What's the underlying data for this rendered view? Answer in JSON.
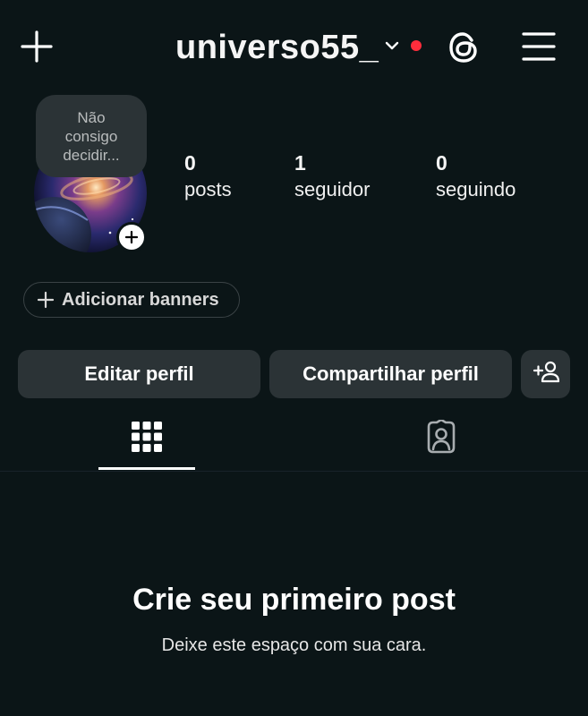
{
  "header": {
    "username": "universo55_",
    "icons": {
      "create": "plus-icon",
      "account_switch": "chevron-down-icon",
      "threads": "threads-icon",
      "menu": "hamburger-menu-icon"
    },
    "notification_dot_color": "#ff2d3c"
  },
  "profile": {
    "note": "Não\nconsigo\ndecidir...",
    "avatar": "galaxy-avatar-image",
    "add_story_icon": "plus-icon",
    "stats": [
      {
        "value": "0",
        "label": "posts"
      },
      {
        "value": "1",
        "label": "seguidor"
      },
      {
        "value": "0",
        "label": "seguindo"
      }
    ]
  },
  "banners": {
    "label": "Adicionar banners",
    "icon": "plus-icon"
  },
  "actions": {
    "edit_label": "Editar perfil",
    "share_label": "Compartilhar perfil",
    "discover_icon": "add-person-icon"
  },
  "tabs": [
    {
      "name": "posts-grid",
      "icon": "grid-icon",
      "active": true
    },
    {
      "name": "tagged",
      "icon": "tagged-person-icon",
      "active": false
    }
  ],
  "empty_state": {
    "title": "Crie seu primeiro post",
    "subtitle": "Deixe este espaço com sua cara."
  },
  "colors": {
    "background": "#0b1517",
    "button_bg": "#2b3336",
    "text": "#ffffff"
  }
}
